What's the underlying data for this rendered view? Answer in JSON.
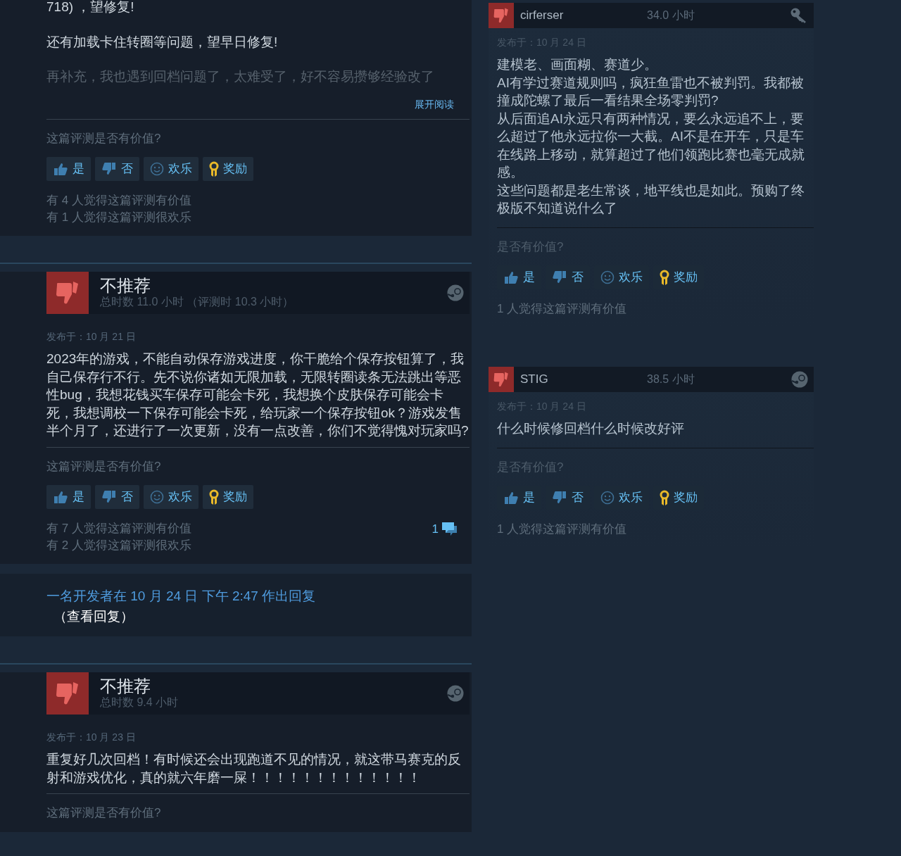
{
  "left_reviews": [
    {
      "paragraphs": [
        {
          "text": "718) ，望修复!",
          "faded": false
        },
        {
          "text": "还有加载卡住转圈等问题，望早日修复!",
          "faded": false
        },
        {
          "text": "再补充，我也遇到回档问题了，太难受了，好不容易攒够经验改了",
          "faded": true
        }
      ],
      "read_more": "展开阅读",
      "question": "这篇评测是否有价值?",
      "buttons": [
        {
          "kind": "yes",
          "label": "是"
        },
        {
          "kind": "no",
          "label": "否"
        },
        {
          "kind": "funny",
          "label": "欢乐"
        },
        {
          "kind": "award",
          "label": "奖励"
        }
      ],
      "counts": [
        "有 4 人觉得这篇评测有价值",
        "有 1 人觉得这篇评测很欢乐"
      ]
    },
    {
      "recommendation": "不推荐",
      "hours": "总时数 11.0 小时 （评测时 10.3 小时）",
      "posted": "发布于：10 月 21 日",
      "paragraphs": [
        {
          "text": "2023年的游戏，不能自动保存游戏进度，你干脆给个保存按钮算了，我自己保存行不行。先不说你诸如无限加载，无限转圈读条无法跳出等恶性bug，我想花钱买车保存可能会卡死，我想换个皮肤保存可能会卡死，我想调校一下保存可能会卡死，给玩家一个保存按钮ok？游戏发售半个月了，还进行了一次更新，没有一点改善，你们不觉得愧对玩家吗?",
          "faded": false
        }
      ],
      "question": "这篇评测是否有价值?",
      "buttons": [
        {
          "kind": "yes",
          "label": "是"
        },
        {
          "kind": "no",
          "label": "否"
        },
        {
          "kind": "funny",
          "label": "欢乐"
        },
        {
          "kind": "award",
          "label": "奖励"
        }
      ],
      "counts": [
        "有 7 人觉得这篇评测有价值",
        "有 2 人觉得这篇评测很欢乐"
      ],
      "comments": "1",
      "developer_reply": {
        "text": "一名开发者在 10 月 24 日 下午 2:47 作出回复",
        "link": "（查看回复）"
      }
    },
    {
      "recommendation": "不推荐",
      "hours": "总时数 9.4 小时",
      "posted": "发布于：10 月 23 日",
      "paragraphs": [
        {
          "text": "重复好几次回档！有时候还会出现跑道不见的情况，就这带马赛克的反射和游戏优化，真的就六年磨一屎！！！！！！！！！！！！！",
          "faded": false
        }
      ],
      "question": "这篇评测是否有价值?"
    }
  ],
  "right_reviews": [
    {
      "author": "cirferser",
      "hours": "34.0 小时",
      "kind": "key",
      "posted": "发布于：10 月 24 日",
      "lines": [
        "建模老、画面糊、赛道少。",
        "AI有学过赛道规则吗，疯狂鱼雷也不被判罚。我都被撞成陀螺了最后一看结果全场零判罚?",
        "从后面追AI永远只有两种情况，要么永远追不上，要么超过了他永远拉你一大截。AI不是在开车，只是车在线路上移动，就算超过了他们领跑比赛也毫无成就感。",
        "这些问题都是老生常谈，地平线也是如此。预购了终极版不知道说什么了"
      ],
      "question": "是否有价值?",
      "buttons": [
        {
          "kind": "yes",
          "label": "是"
        },
        {
          "kind": "no",
          "label": "否"
        },
        {
          "kind": "funny",
          "label": "欢乐"
        },
        {
          "kind": "award",
          "label": "奖励"
        }
      ],
      "counts": [
        "1 人觉得这篇评测有价值"
      ]
    },
    {
      "author": "STIG",
      "hours": "38.5 小时",
      "kind": "steam",
      "posted": "发布于：10 月 24 日",
      "lines": [
        "什么时候修回档什么时候改好评"
      ],
      "question": "是否有价值?",
      "buttons": [
        {
          "kind": "yes",
          "label": "是"
        },
        {
          "kind": "no",
          "label": "否"
        },
        {
          "kind": "funny",
          "label": "欢乐"
        },
        {
          "kind": "award",
          "label": "奖励"
        }
      ],
      "counts": [
        "1 人觉得这篇评测有价值"
      ]
    }
  ]
}
